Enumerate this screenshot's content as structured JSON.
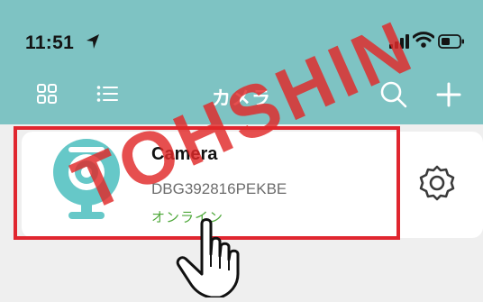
{
  "status_bar": {
    "time": "11:51",
    "icons": [
      "location-arrow-icon",
      "cellular-signal-icon",
      "wifi-icon",
      "battery-icon"
    ]
  },
  "nav": {
    "title": "カメラ",
    "left_icons": [
      "grid-view-icon",
      "list-view-icon"
    ],
    "right_icons": [
      "search-icon",
      "plus-icon"
    ]
  },
  "device": {
    "name": "Camera",
    "id": "DBG392816PEKBE",
    "status": "オンライン",
    "icon": "camera-icon",
    "settings_icon": "gear-icon"
  },
  "overlay": {
    "watermark": "TOHSHIN",
    "highlight_color": "#e0262f",
    "pointer_icon": "hand-pointer-icon"
  },
  "colors": {
    "header_bg": "#7ec3c3",
    "accent_teal": "#66c8c8",
    "online_green": "#4ea83a",
    "page_bg": "#efefef"
  }
}
